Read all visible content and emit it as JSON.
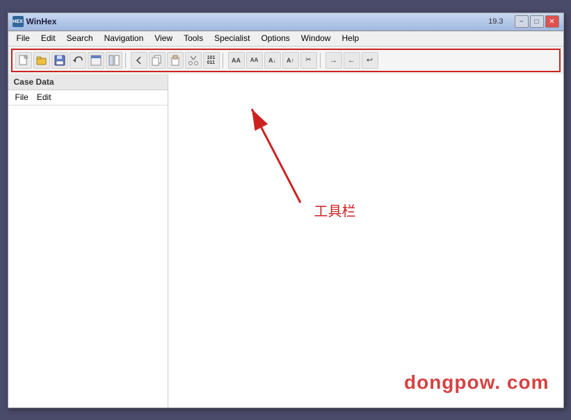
{
  "window": {
    "title": "WinHex",
    "version": "19.3",
    "icon_label": "HEX"
  },
  "title_bar": {
    "minimize_label": "−",
    "maximize_label": "□",
    "close_label": "✕"
  },
  "menu_bar": {
    "items": [
      {
        "label": "File",
        "id": "file"
      },
      {
        "label": "Edit",
        "id": "edit"
      },
      {
        "label": "Search",
        "id": "search"
      },
      {
        "label": "Navigation",
        "id": "navigation"
      },
      {
        "label": "View",
        "id": "view"
      },
      {
        "label": "Tools",
        "id": "tools"
      },
      {
        "label": "Specialist",
        "id": "specialist"
      },
      {
        "label": "Options",
        "id": "options"
      },
      {
        "label": "Window",
        "id": "window"
      },
      {
        "label": "Help",
        "id": "help"
      }
    ]
  },
  "toolbar": {
    "buttons": [
      {
        "icon": "📄",
        "label": "new"
      },
      {
        "icon": "📂",
        "label": "open"
      },
      {
        "icon": "💾",
        "label": "save"
      },
      {
        "icon": "↩",
        "label": "undo"
      },
      {
        "icon": "🖼",
        "label": "view1"
      },
      {
        "icon": "📋",
        "label": "view2"
      },
      {
        "separator": true
      },
      {
        "icon": "↩",
        "label": "back"
      },
      {
        "icon": "📑",
        "label": "copy"
      },
      {
        "icon": "📑",
        "label": "paste"
      },
      {
        "icon": "📑",
        "label": "cut"
      },
      {
        "icon": "101",
        "label": "bin"
      },
      {
        "separator": true
      },
      {
        "icon": "AA",
        "label": "find1"
      },
      {
        "icon": "AA",
        "label": "find2"
      },
      {
        "icon": "A↓",
        "label": "find3"
      },
      {
        "icon": "A↑",
        "label": "find4"
      },
      {
        "icon": "✂",
        "label": "find5"
      },
      {
        "separator": true
      },
      {
        "icon": "→",
        "label": "nav1"
      },
      {
        "icon": "←",
        "label": "nav2"
      },
      {
        "icon": "↩",
        "label": "nav3"
      }
    ]
  },
  "sidebar": {
    "header": "Case Data",
    "menu_items": [
      {
        "label": "File"
      },
      {
        "label": "Edit"
      }
    ]
  },
  "annotation": {
    "arrow_text": "工具栏"
  },
  "watermark": {
    "text": "dongpow. com"
  }
}
